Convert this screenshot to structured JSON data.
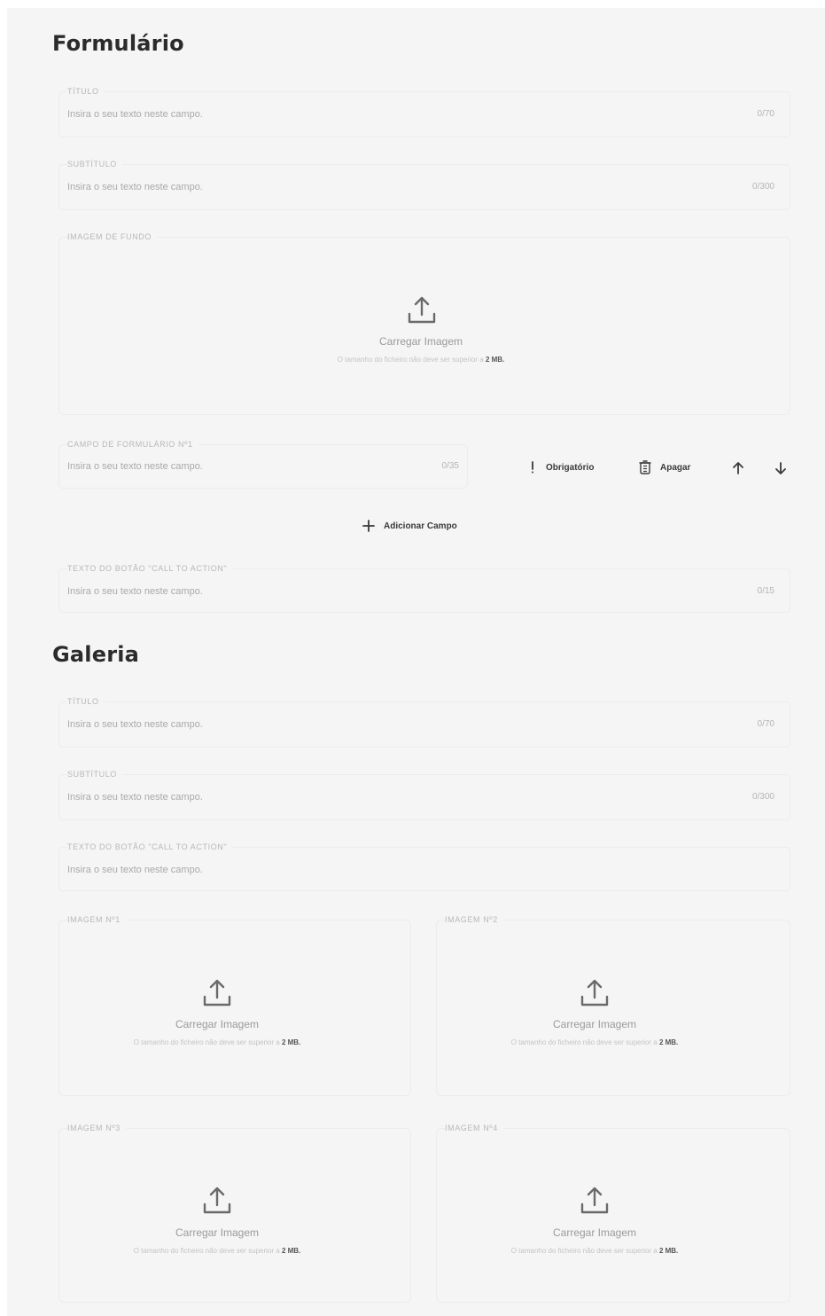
{
  "form_section": {
    "title": "Formulário",
    "title_field": {
      "label": "Título",
      "placeholder": "Insira o seu texto neste campo.",
      "counter": "0/70"
    },
    "subtitle_field": {
      "label": "Subtítulo",
      "placeholder": "Insira o seu texto neste campo.",
      "counter": "0/300"
    },
    "background_image": {
      "label": "Imagem de fundo",
      "upload_label": "Carregar Imagem",
      "hint": "O tamanho do ficheiro não deve ser superior a",
      "hint_size": "2 MB."
    },
    "form_field_1": {
      "label": "Campo de formulário Nº1",
      "placeholder": "Insira o seu texto neste campo.",
      "counter": "0/35"
    },
    "required_label": "Obrigatório",
    "delete_label": "Apagar",
    "add_field_label": "Adicionar Campo",
    "cta_field": {
      "label": "Texto do botão \"Call to action\"",
      "placeholder": "Insira o seu texto neste campo.",
      "counter": "0/15"
    }
  },
  "gallery_section": {
    "title": "Galeria",
    "title_field": {
      "label": "Título",
      "placeholder": "Insira o seu texto neste campo.",
      "counter": "0/70"
    },
    "subtitle_field": {
      "label": "Subtítulo",
      "placeholder": "Insira o seu texto neste campo.",
      "counter": "0/300"
    },
    "cta_field": {
      "label": "Texto do botão \"Call to action\"",
      "placeholder": "Insira o seu texto neste campo."
    },
    "images": [
      {
        "label": "Imagem Nº1",
        "upload_label": "Carregar Imagem",
        "hint": "O tamanho do ficheiro não deve ser superior a",
        "hint_size": "2 MB."
      },
      {
        "label": "Imagem Nº2",
        "upload_label": "Carregar Imagem",
        "hint": "O tamanho do ficheiro não deve ser superior a",
        "hint_size": "2 MB."
      },
      {
        "label": "Imagem Nº3",
        "upload_label": "Carregar Imagem",
        "hint": "O tamanho do ficheiro não deve ser superior a",
        "hint_size": "2 MB."
      },
      {
        "label": "Imagem Nº4",
        "upload_label": "Carregar Imagem",
        "hint": "O tamanho do ficheiro não deve ser superior a",
        "hint_size": "2 MB."
      }
    ]
  },
  "icons": {
    "upload": "upload-icon",
    "required": "exclamation-icon",
    "delete": "trash-icon",
    "move_up": "arrow-up-icon",
    "move_down": "arrow-down-icon",
    "add": "plus-icon"
  }
}
